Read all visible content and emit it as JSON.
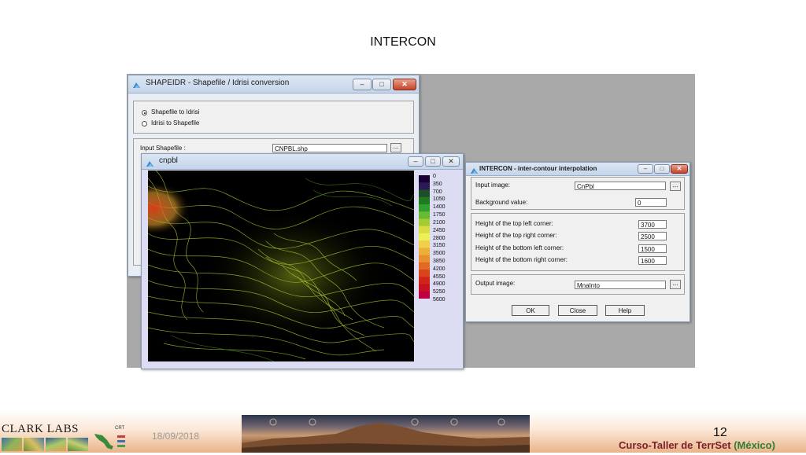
{
  "slide": {
    "title": "INTERCON",
    "date": "18/09/2018",
    "page_number": "12",
    "course": "Curso-Taller de TerrSet",
    "country": "(México)",
    "logo": "CLARK LABS",
    "logo_small": "CRT"
  },
  "shapeidr": {
    "title": "SHAPEIDR - Shapefile / Idrisi conversion",
    "options": [
      "Shapefile to Idrisi",
      "Idrisi to Shapefile"
    ],
    "selected": 0,
    "input_label": "Input Shapefile :",
    "input_value": "CNPBL.shp"
  },
  "cnpbl": {
    "title": "cnpbl",
    "legend": [
      "0",
      "350",
      "700",
      "1050",
      "1400",
      "1750",
      "2100",
      "2450",
      "2800",
      "3150",
      "3500",
      "3850",
      "4200",
      "4550",
      "4900",
      "5250",
      "5600"
    ],
    "legend_colors": [
      "#1a0033",
      "#2a1a55",
      "#1f4d2a",
      "#1f7a1f",
      "#2fa02f",
      "#66bb33",
      "#a3cc33",
      "#d8dd44",
      "#eeee55",
      "#f0d048",
      "#ecb03a",
      "#e8902e",
      "#e06a24",
      "#d8441c",
      "#d02418",
      "#c81024",
      "#c00040"
    ]
  },
  "intercon": {
    "title": "INTERCON - inter-contour interpolation",
    "input_label": "Input image:",
    "input_value": "CnPbl",
    "bg_label": "Background value:",
    "bg_value": "0",
    "corners": [
      {
        "label": "Height of the top left corner:",
        "value": "3700"
      },
      {
        "label": "Height of the top right corner:",
        "value": "2500"
      },
      {
        "label": "Height of the bottom left corner:",
        "value": "1500"
      },
      {
        "label": "Height of the bottom right corner:",
        "value": "1600"
      }
    ],
    "output_label": "Output image:",
    "output_value": "MnaInto",
    "buttons": {
      "ok": "OK",
      "close": "Close",
      "help": "Help"
    },
    "dots": "..."
  }
}
